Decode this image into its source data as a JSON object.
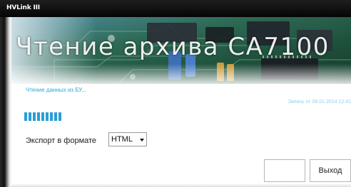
{
  "window": {
    "title": "HVLink III"
  },
  "banner": {
    "heading": "Чтение архива СА7100"
  },
  "status": {
    "message": "Чтение данных из БУ...",
    "record": "Запись от 08.01.2014 12:41",
    "progress_segments": 9
  },
  "export": {
    "label": "Экспорт в формате",
    "format": "HTML",
    "arrow_icon": "chevron-down-icon"
  },
  "buttons": {
    "blank_label": "",
    "exit_label": "Выход"
  },
  "colors": {
    "accent": "#2a9fd6",
    "status_text": "#29a9d8",
    "titlebar": "#111111",
    "pcb_green": "#1f5a3a"
  }
}
